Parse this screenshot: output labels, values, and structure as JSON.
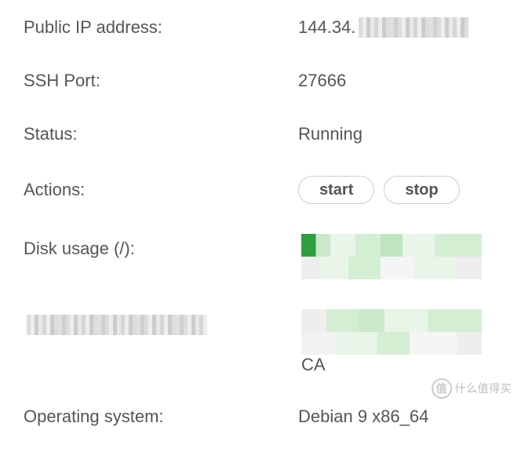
{
  "rows": {
    "ip": {
      "label": "Public IP address:",
      "prefix": "144.34."
    },
    "ssh": {
      "label": "SSH Port:",
      "value": "27666"
    },
    "status": {
      "label": "Status:",
      "value": "Running"
    },
    "actions": {
      "label": "Actions:",
      "start": "start",
      "stop": "stop"
    },
    "disk": {
      "label": "Disk usage (/):"
    },
    "row6": {
      "suffix": "CA"
    },
    "os": {
      "label": "Operating system:",
      "value": "Debian 9 x86_64"
    }
  },
  "watermark": {
    "icon": "值",
    "text": "什么值得买"
  }
}
